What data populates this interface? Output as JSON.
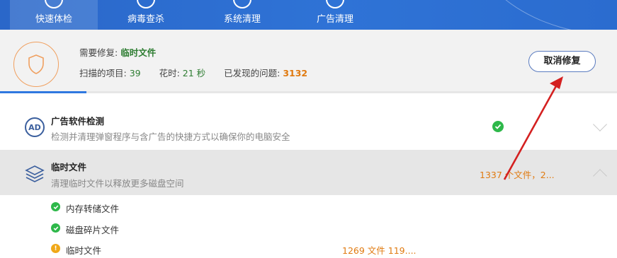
{
  "nav": {
    "tabs": [
      {
        "label": "快速体检",
        "icon": "health-check-icon",
        "active": true
      },
      {
        "label": "病毒查杀",
        "icon": "virus-scan-icon",
        "active": false
      },
      {
        "label": "系统清理",
        "icon": "broom-icon",
        "active": false
      },
      {
        "label": "广告清理",
        "icon": "ad-block-icon",
        "active": false
      }
    ]
  },
  "status": {
    "repair_label": "需要修复:",
    "repair_value": "临时文件",
    "scanned_label": "扫描的项目:",
    "scanned_value": "39",
    "time_label": "花时:",
    "time_value": "21 秒",
    "issues_label": "已发现的问题:",
    "issues_value": "3132",
    "cancel_button": "取消修复",
    "progress_fraction": 0.14
  },
  "rows": {
    "ad": {
      "title": "广告软件检测",
      "desc": "检测并清理弹窗程序与含广告的快捷方式以确保你的电脑安全",
      "icon_text": "AD",
      "status": "ok"
    },
    "temp": {
      "title": "临时文件",
      "desc": "清理临时文件以释放更多磁盘空间",
      "summary": "1337 个文件，2...",
      "sub_items": [
        {
          "label": "内存转储文件",
          "status": "ok",
          "value": ""
        },
        {
          "label": "磁盘碎片文件",
          "status": "ok",
          "value": ""
        },
        {
          "label": "临时文件",
          "status": "warn",
          "value": "1269 文件 119...."
        }
      ]
    }
  },
  "colors": {
    "nav_blue": "#2f73d6",
    "ok_green": "#2eb84a",
    "warn_orange": "#e07a10",
    "annotation_red": "#d42020"
  }
}
